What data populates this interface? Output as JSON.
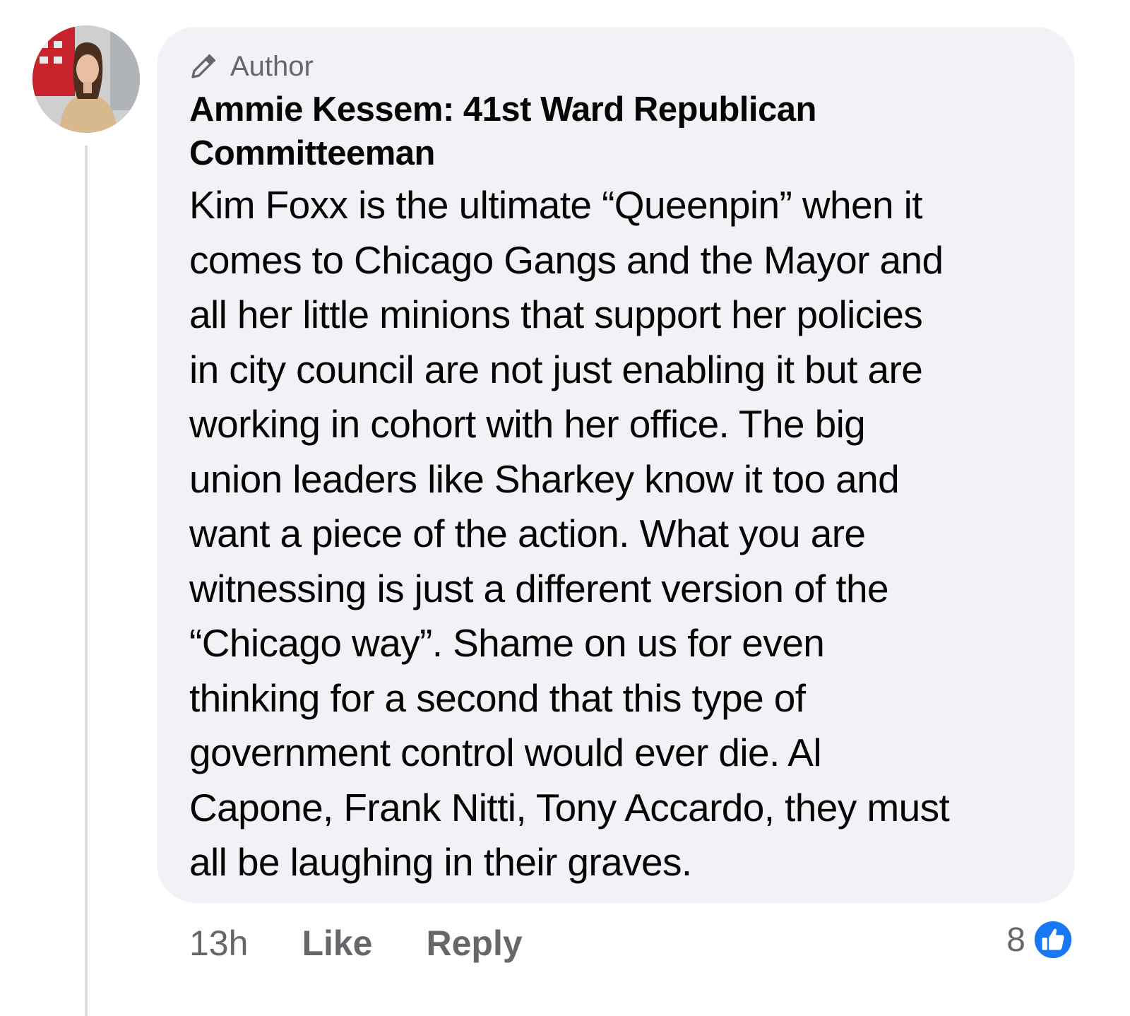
{
  "comment": {
    "badge_label": "Author",
    "badge_icon": "pencil-icon",
    "author_name_line1": "Ammie Kessem: 41st Ward Republican",
    "author_name_line2": "Committeeman",
    "body_lines": [
      "Kim Foxx is the ultimate “Queenpin” when it",
      "comes to Chicago Gangs and the Mayor and",
      "all her little minions that support her policies",
      "in city council are not just enabling it but are",
      "working in cohort with her office. The big",
      "union leaders like Sharkey know it too and",
      "want a piece of the action. What you are",
      "witnessing is just a different version of the",
      "“Chicago way”. Shame on us for even",
      "thinking for a second that this type of",
      "government control would ever die. Al",
      "Capone, Frank Nitti, Tony Accardo, they must",
      "all be laughing in their graves."
    ]
  },
  "actions": {
    "timestamp": "13h",
    "like_label": "Like",
    "reply_label": "Reply"
  },
  "reactions": {
    "count": "8",
    "icon": "like-thumbs-up-icon",
    "accent_color": "#1877f2"
  },
  "colors": {
    "bubble": "#f0f2f5",
    "text": "#050505",
    "secondary": "#65676b"
  }
}
